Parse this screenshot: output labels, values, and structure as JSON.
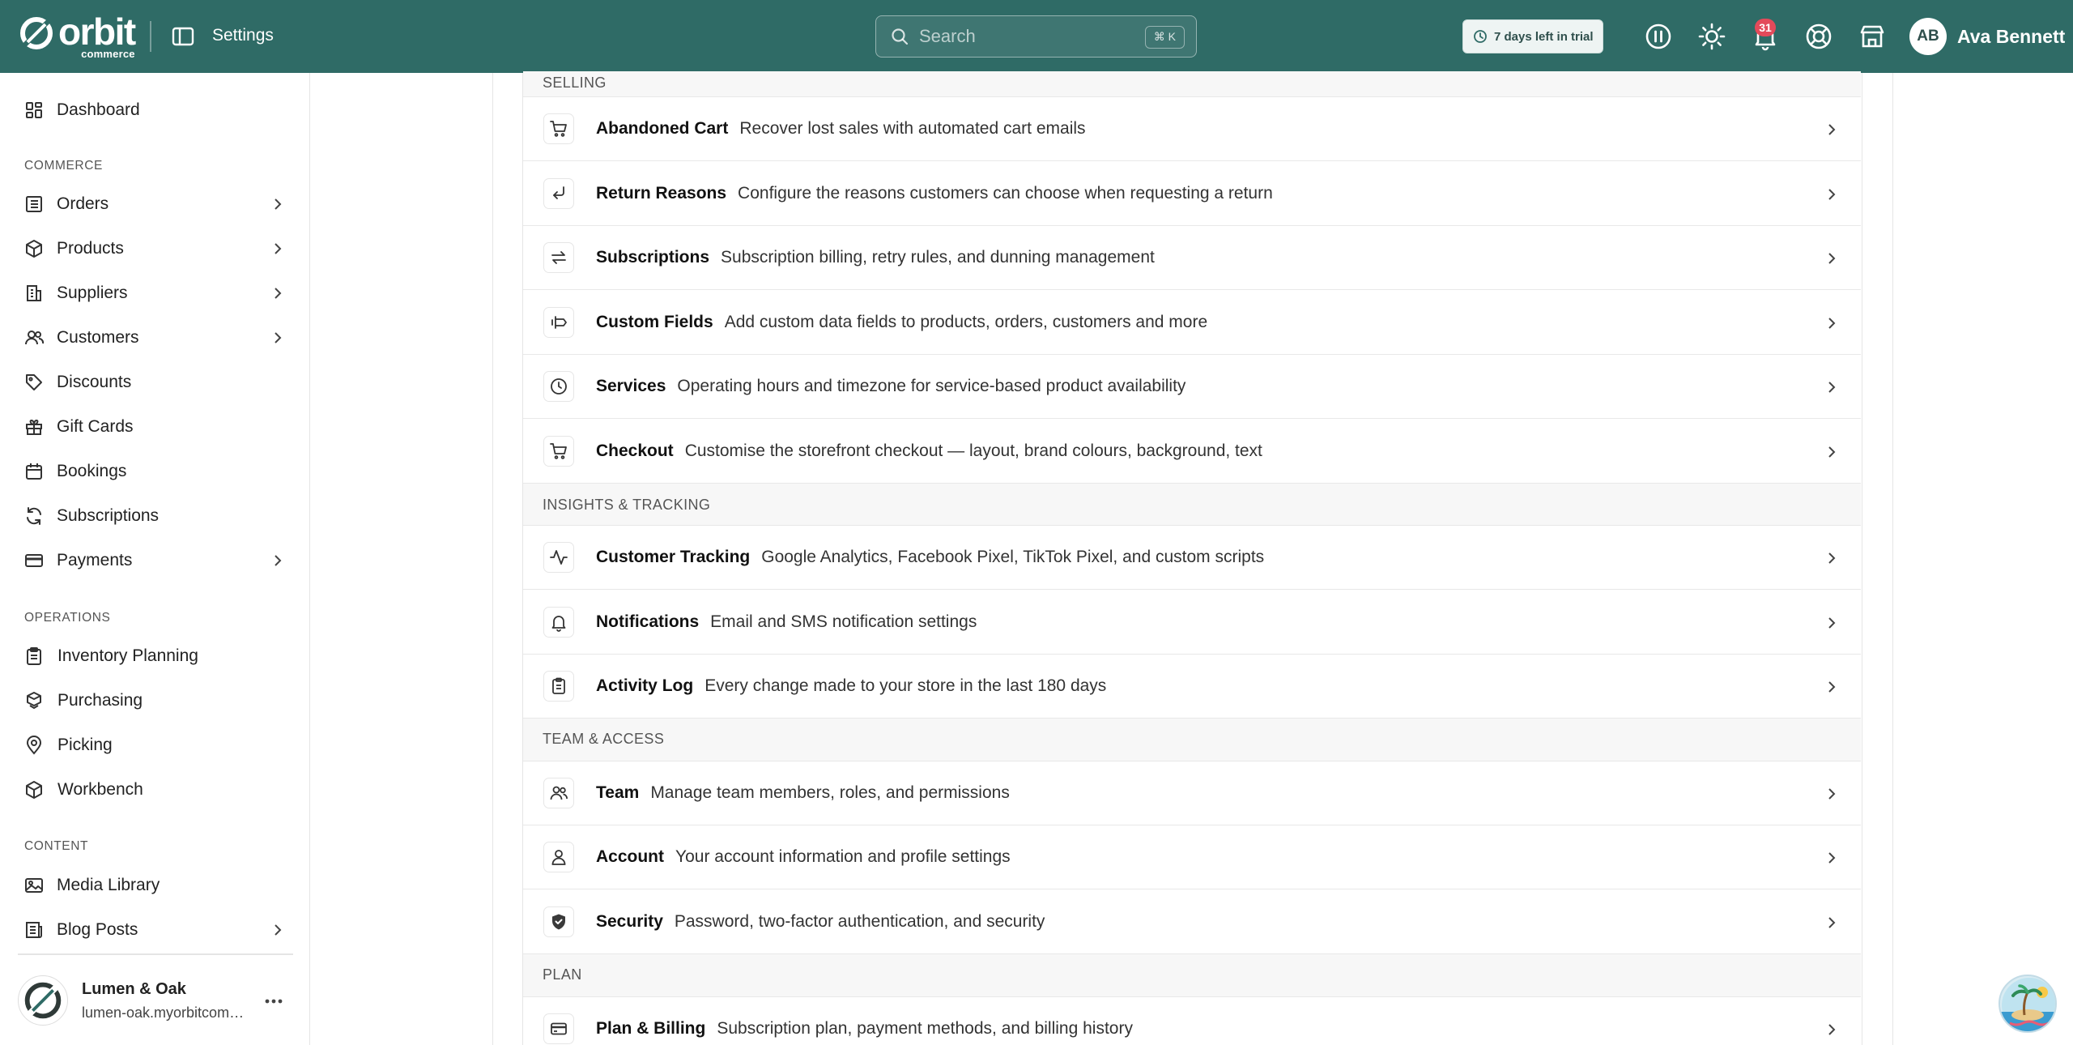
{
  "topbar": {
    "logo_word": "orbit",
    "logo_sub": "commerce",
    "page_title": "Settings",
    "search_placeholder": "Search",
    "search_shortcut": "⌘ K",
    "trial_label": "7 days left in trial",
    "notification_count": "31",
    "user_initials": "AB",
    "user_name": "Ava Bennett",
    "icons": [
      "sidebar-toggle-icon",
      "search-icon",
      "clock-icon",
      "pause-icon",
      "sun-icon",
      "bell-icon",
      "help-lifebuoy-icon",
      "store-icon"
    ]
  },
  "sidebar": {
    "dashboard": "Dashboard",
    "sections": {
      "commerce": "COMMERCE",
      "operations": "OPERATIONS",
      "content": "CONTENT"
    },
    "commerce_items": [
      {
        "label": "Orders",
        "icon": "orders-icon",
        "expandable": true
      },
      {
        "label": "Products",
        "icon": "box-icon",
        "expandable": true
      },
      {
        "label": "Suppliers",
        "icon": "building-icon",
        "expandable": true
      },
      {
        "label": "Customers",
        "icon": "users-icon",
        "expandable": true
      },
      {
        "label": "Discounts",
        "icon": "tag-icon",
        "expandable": false
      },
      {
        "label": "Gift Cards",
        "icon": "gift-icon",
        "expandable": false
      },
      {
        "label": "Bookings",
        "icon": "calendar-icon",
        "expandable": false
      },
      {
        "label": "Subscriptions",
        "icon": "refresh-icon",
        "expandable": false
      },
      {
        "label": "Payments",
        "icon": "card-icon",
        "expandable": true
      }
    ],
    "operations_items": [
      {
        "label": "Inventory Planning",
        "icon": "clipboard-icon"
      },
      {
        "label": "Purchasing",
        "icon": "boxes-icon"
      },
      {
        "label": "Picking",
        "icon": "location-pin-icon"
      },
      {
        "label": "Workbench",
        "icon": "workbench-icon"
      }
    ],
    "content_items": [
      {
        "label": "Media Library",
        "icon": "image-icon",
        "expandable": false
      },
      {
        "label": "Blog Posts",
        "icon": "newspaper-icon",
        "expandable": true
      }
    ],
    "store": {
      "name": "Lumen & Oak",
      "url": "lumen-oak.myorbitcommerce.com"
    }
  },
  "settings": {
    "selling_header": "SELLING",
    "selling": [
      {
        "title": "Abandoned Cart",
        "desc": "Recover lost sales with automated cart emails",
        "icon": "cart-icon"
      },
      {
        "title": "Return Reasons",
        "desc": "Configure the reasons customers can choose when requesting a return",
        "icon": "return-arrow-icon"
      },
      {
        "title": "Subscriptions",
        "desc": "Subscription billing, retry rules, and dunning management",
        "icon": "swap-arrows-icon"
      },
      {
        "title": "Custom Fields",
        "desc": "Add custom data fields to products, orders, customers and more",
        "icon": "custom-field-icon"
      },
      {
        "title": "Services",
        "desc": "Operating hours and timezone for service-based product availability",
        "icon": "clock-icon"
      },
      {
        "title": "Checkout",
        "desc": "Customise the storefront checkout — layout, brand colours, background, text",
        "icon": "cart-icon"
      }
    ],
    "insights_header": "INSIGHTS & TRACKING",
    "insights": [
      {
        "title": "Customer Tracking",
        "desc": "Google Analytics, Facebook Pixel, TikTok Pixel, and custom scripts",
        "icon": "activity-icon"
      },
      {
        "title": "Notifications",
        "desc": "Email and SMS notification settings",
        "icon": "bell-icon"
      },
      {
        "title": "Activity Log",
        "desc": "Every change made to your store in the last 180 days",
        "icon": "clipboard-list-icon"
      }
    ],
    "team_header": "TEAM & ACCESS",
    "team": [
      {
        "title": "Team",
        "desc": "Manage team members, roles, and permissions",
        "icon": "users-icon"
      },
      {
        "title": "Account",
        "desc": "Your account information and profile settings",
        "icon": "user-icon"
      },
      {
        "title": "Security",
        "desc": "Password, two-factor authentication, and security",
        "icon": "shield-check-icon"
      }
    ],
    "plan_header": "PLAN",
    "plan": [
      {
        "title": "Plan & Billing",
        "desc": "Subscription plan, payment methods, and billing history",
        "icon": "card-icon"
      }
    ]
  },
  "colors": {
    "brand": "#2f6b66",
    "badge": "#e34a5a"
  }
}
